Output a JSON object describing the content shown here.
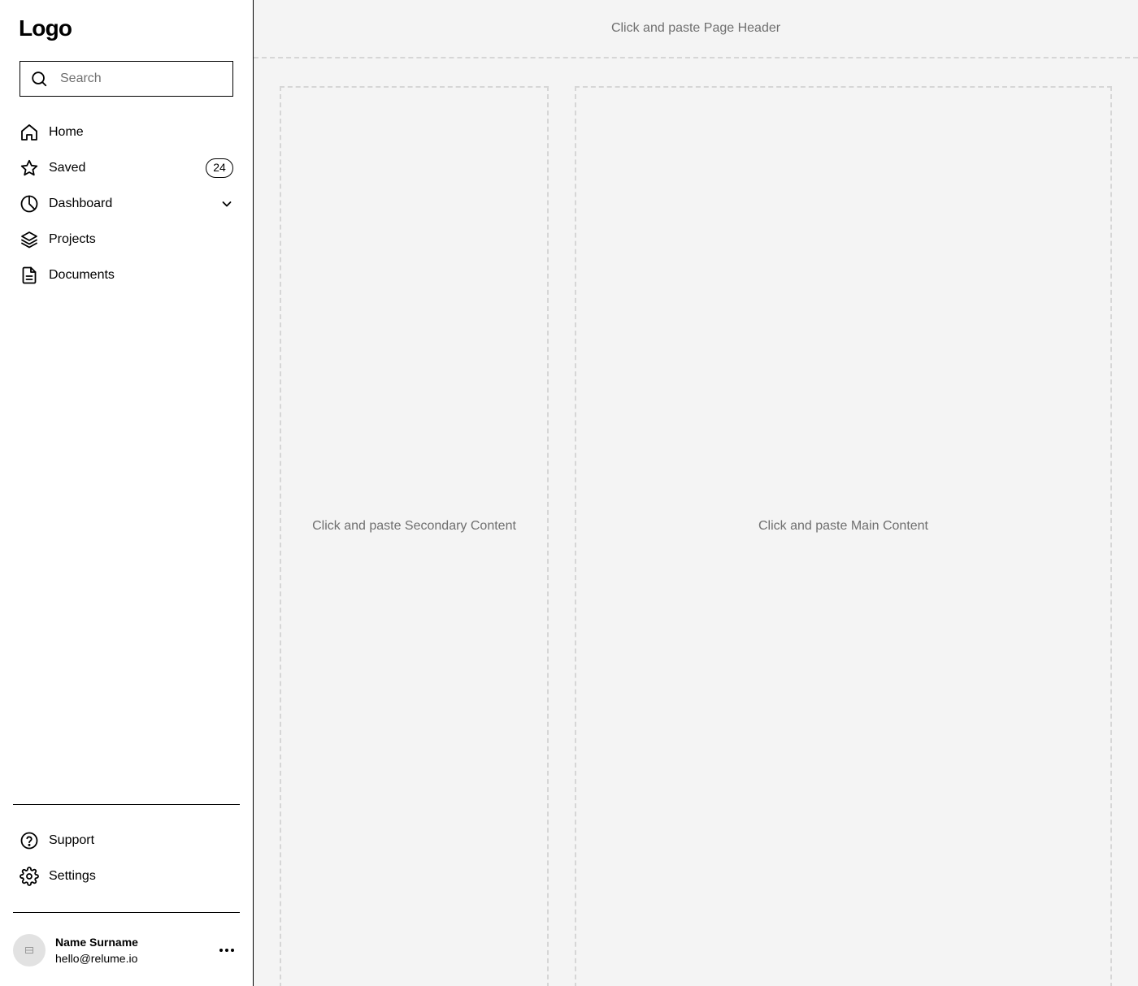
{
  "sidebar": {
    "logo": "Logo",
    "search": {
      "placeholder": "Search",
      "icon": "search-icon"
    },
    "nav": [
      {
        "label": "Home",
        "icon": "home-icon"
      },
      {
        "label": "Saved",
        "icon": "star-icon",
        "badge": "24"
      },
      {
        "label": "Dashboard",
        "icon": "pie-chart-icon",
        "has_dropdown": true
      },
      {
        "label": "Projects",
        "icon": "layers-icon"
      },
      {
        "label": "Documents",
        "icon": "document-icon"
      }
    ],
    "bottom_nav": [
      {
        "label": "Support",
        "icon": "help-circle-icon"
      },
      {
        "label": "Settings",
        "icon": "gear-icon"
      }
    ],
    "user": {
      "name": "Name Surname",
      "email": "hello@relume.io"
    }
  },
  "main": {
    "header_placeholder": "Click and paste Page Header",
    "secondary_placeholder": "Click and paste Secondary Content",
    "main_placeholder": "Click and paste Main Content"
  },
  "colors": {
    "border": "#000000",
    "placeholder_text": "#6f6f6f",
    "main_background": "#f4f4f4",
    "dashed_border": "#d6d6d6",
    "avatar_background": "#e2e2e2"
  }
}
